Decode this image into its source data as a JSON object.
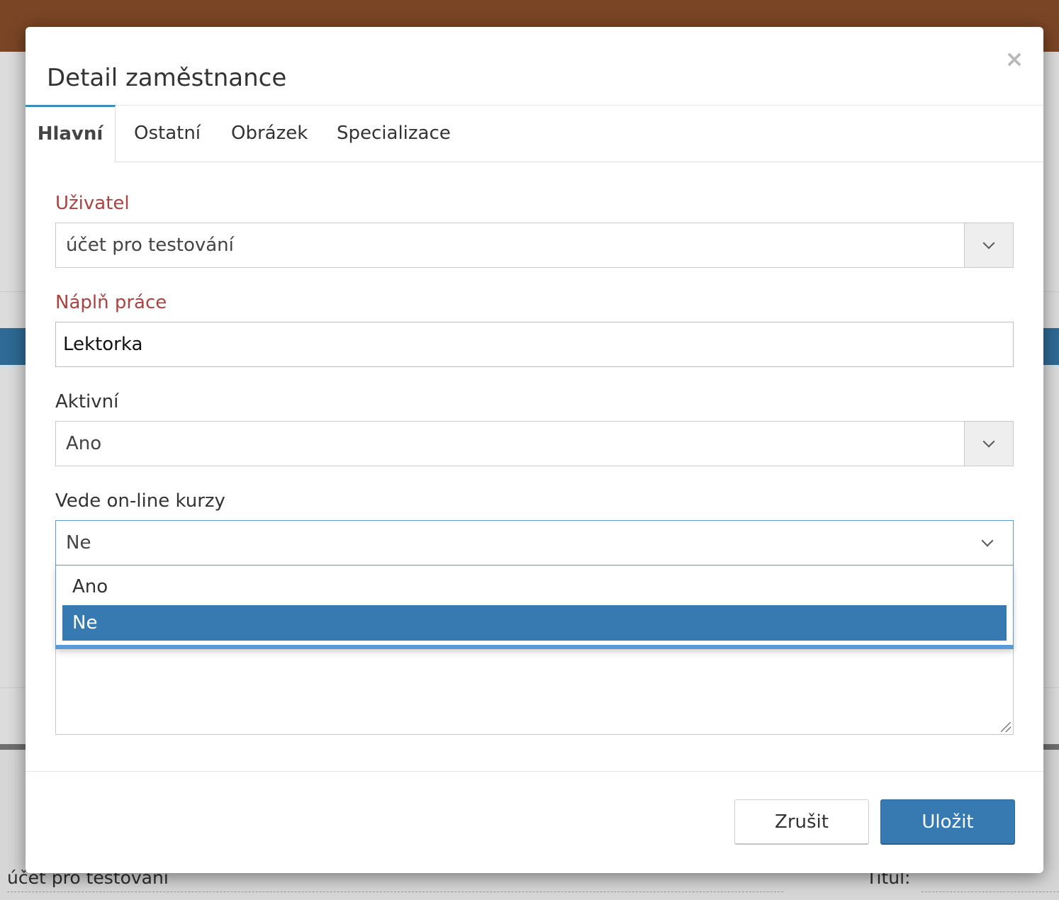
{
  "background": {
    "bottom_left_text": "účet pro testování",
    "bottom_right_text": "Titul:"
  },
  "modal": {
    "title": "Detail zaměstnance",
    "close_symbol": "×"
  },
  "tabs": [
    {
      "label": "Hlavní",
      "active": true
    },
    {
      "label": "Ostatní",
      "active": false
    },
    {
      "label": "Obrázek",
      "active": false
    },
    {
      "label": "Specializace",
      "active": false
    }
  ],
  "form": {
    "user": {
      "label": "Uživatel",
      "value": "účet pro testování",
      "required": true
    },
    "job": {
      "label": "Náplň práce",
      "value": "Lektorka",
      "required": true
    },
    "active": {
      "label": "Aktivní",
      "value": "Ano"
    },
    "online": {
      "label": "Vede on-line kurzy",
      "value": "Ne",
      "options": [
        {
          "label": "Ano",
          "selected": false
        },
        {
          "label": "Ne",
          "selected": true
        }
      ]
    }
  },
  "footer": {
    "cancel_label": "Zrušit",
    "save_label": "Uložit"
  },
  "colors": {
    "accent": "#3779b1",
    "required_label": "#a94442",
    "topbar": "#7a4525"
  },
  "icons": {
    "close": "close-icon",
    "select_arrow": "chevron-down-icon",
    "resize": "resize-grip-icon"
  }
}
